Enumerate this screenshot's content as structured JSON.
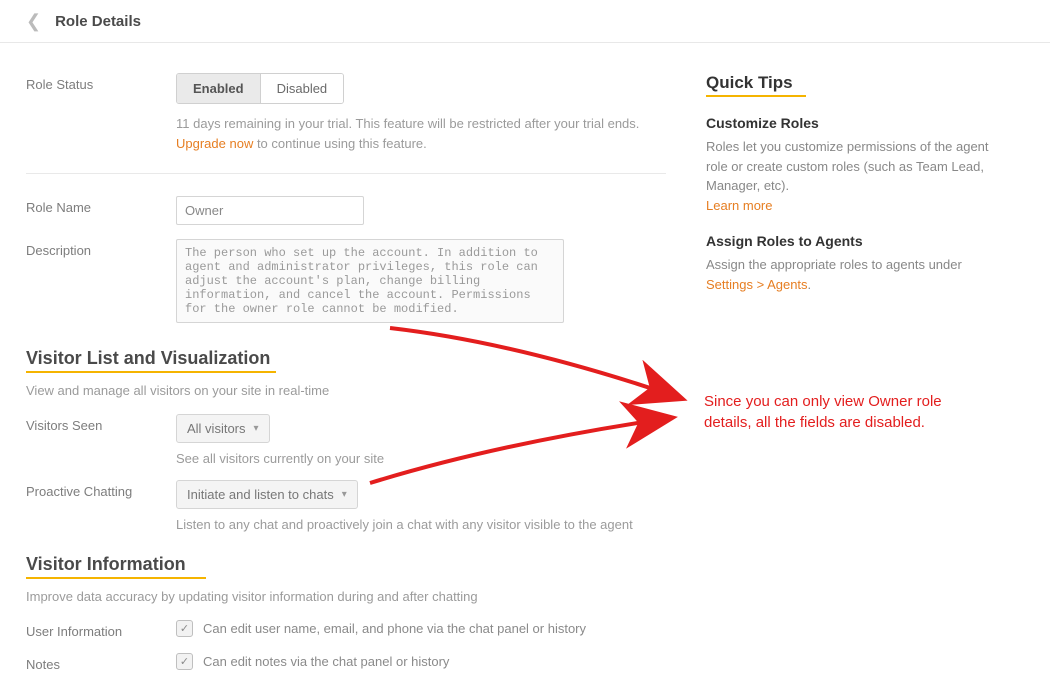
{
  "header": {
    "title": "Role Details"
  },
  "status": {
    "label": "Role Status",
    "enabled": "Enabled",
    "disabled": "Disabled",
    "trial_line1": "11 days remaining in your trial. This feature will be restricted after your trial ends.",
    "upgrade_link": "Upgrade now",
    "trial_line2": " to continue using this feature."
  },
  "name": {
    "label": "Role Name",
    "value": "Owner"
  },
  "desc": {
    "label": "Description",
    "value": "The person who set up the account. In addition to agent and administrator privileges, this role can adjust the account's plan, change billing information, and cancel the account. Permissions for the owner role cannot be modified."
  },
  "sec_visitor": {
    "title": "Visitor List and Visualization",
    "sub": "View and manage all visitors on your site in real-time",
    "seen_label": "Visitors Seen",
    "seen_value": "All visitors",
    "seen_help": "See all visitors currently on your site",
    "proactive_label": "Proactive Chatting",
    "proactive_value": "Initiate and listen to chats",
    "proactive_help": "Listen to any chat and proactively join a chat with any visitor visible to the agent"
  },
  "sec_info": {
    "title": "Visitor Information",
    "sub": "Improve data accuracy by updating visitor information during and after chatting",
    "user_label": "User Information",
    "user_desc": "Can edit user name, email, and phone via the chat panel or history",
    "notes_label": "Notes",
    "notes_desc": "Can edit notes via the chat panel or history"
  },
  "tips": {
    "heading": "Quick Tips",
    "custom_h": "Customize Roles",
    "custom_p": "Roles let you customize permissions of the agent role or create custom roles (such as Team Lead, Manager, etc).",
    "learn_more": "Learn more",
    "assign_h": "Assign Roles to Agents",
    "assign_p_pre": "Assign the appropriate roles to agents under ",
    "assign_link": "Settings > Agents",
    "assign_p_post": "."
  },
  "callout": {
    "line1": "Since you can only view Owner role",
    "line2": "details, all the fields are disabled."
  }
}
